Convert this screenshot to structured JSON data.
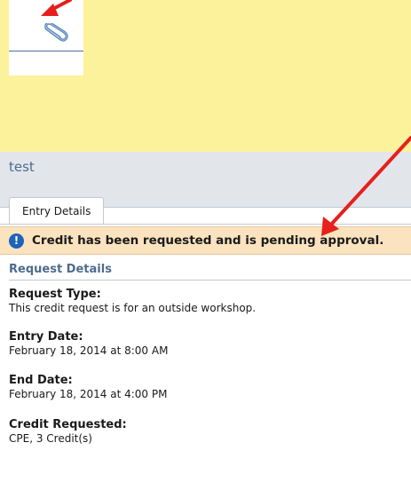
{
  "panel": {
    "title": "test",
    "tab_label": "Entry Details",
    "alert_message": "Credit has been requested and is pending approval.",
    "section_title": "Request Details"
  },
  "fields": [
    {
      "label": "Request Type:",
      "value": "This credit request is for an outside workshop."
    },
    {
      "label": "Entry Date:",
      "value": "February 18, 2014 at 8:00 AM"
    },
    {
      "label": "End Date:",
      "value": "February 18, 2014 at 4:00 PM"
    },
    {
      "label": "Credit Requested:",
      "value": "CPE, 3 Credit(s)"
    }
  ],
  "icons": {
    "attachment": "paperclip-icon",
    "alert": "info-icon"
  },
  "colors": {
    "background": "#fdf29c",
    "arrow": "#e5201d",
    "header_text": "#4e6c8c",
    "alert_bg": "#fbe3bf",
    "info_icon": "#1d63b8"
  }
}
